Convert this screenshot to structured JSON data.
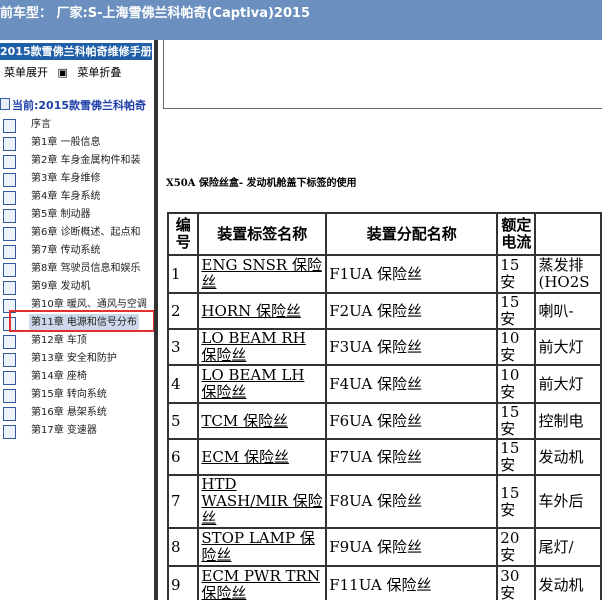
{
  "window": {
    "title": "前车型： 厂家:S-上海雪佛兰科帕奇(Captiva)2015"
  },
  "sidebar": {
    "header": "2015款雪佛兰科帕奇维修手册",
    "expand_label": "菜单展开",
    "collapse_label": "菜单折叠",
    "current_label": "当前:2015款雪佛兰科帕奇",
    "items": [
      {
        "label": "序言"
      },
      {
        "label": "第1章 一般信息"
      },
      {
        "label": "第2章 车身金属构件和装"
      },
      {
        "label": "第3章 车身维修"
      },
      {
        "label": "第4章 车身系统"
      },
      {
        "label": "第5章 制动器"
      },
      {
        "label": "第6章 诊断概述、起点和"
      },
      {
        "label": "第7章 传动系统"
      },
      {
        "label": "第8章 驾驶员信息和娱乐"
      },
      {
        "label": "第9章 发动机"
      },
      {
        "label": "第10章 暖风、通风与空调"
      },
      {
        "label": "第11章 电源和信号分布"
      },
      {
        "label": "第12章 车顶"
      },
      {
        "label": "第13章 安全和防护"
      },
      {
        "label": "第14章 座椅"
      },
      {
        "label": "第15章 转向系统"
      },
      {
        "label": "第16章 悬架系统"
      },
      {
        "label": "第17章 变速器"
      }
    ]
  },
  "main": {
    "section_title": "X50A 保险丝盒- 发动机舱盖下标签的使用",
    "table": {
      "headers": [
        "编号",
        "装置标签名称",
        "装置分配名称",
        "额定电流",
        ""
      ],
      "rows": [
        {
          "num": "1",
          "label": "ENG SNSR 保险丝",
          "assign": "F1UA 保险丝",
          "current": "15 安",
          "extra": "蒸发排(HO2S"
        },
        {
          "num": "2",
          "label": "HORN 保险丝",
          "assign": "F2UA 保险丝",
          "current": "15 安",
          "extra": "喇叭-"
        },
        {
          "num": "3",
          "label": "LO BEAM RH 保险丝",
          "assign": "F3UA 保险丝",
          "current": "10 安",
          "extra": "前大灯"
        },
        {
          "num": "4",
          "label": "LO BEAM LH 保险丝",
          "assign": "F4UA 保险丝",
          "current": "10 安",
          "extra": "前大灯"
        },
        {
          "num": "5",
          "label": "TCM 保险丝",
          "assign": "F6UA 保险丝",
          "current": "15 安",
          "extra": "控制电"
        },
        {
          "num": "6",
          "label": "ECM 保险丝",
          "assign": "F7UA 保险丝",
          "current": "15 安",
          "extra": "发动机"
        },
        {
          "num": "7",
          "label": "HTD WASH/MIR 保险丝",
          "assign": "F8UA 保险丝",
          "current": "15 安",
          "extra": "车外后"
        },
        {
          "num": "8",
          "label": "STOP LAMP 保险丝",
          "assign": "F9UA 保险丝",
          "current": "20 安",
          "extra": "尾灯/"
        },
        {
          "num": "9",
          "label": "ECM PWR TRN 保险丝",
          "assign": "F11UA 保险丝",
          "current": "30 安",
          "extra": "发动机"
        }
      ]
    }
  }
}
